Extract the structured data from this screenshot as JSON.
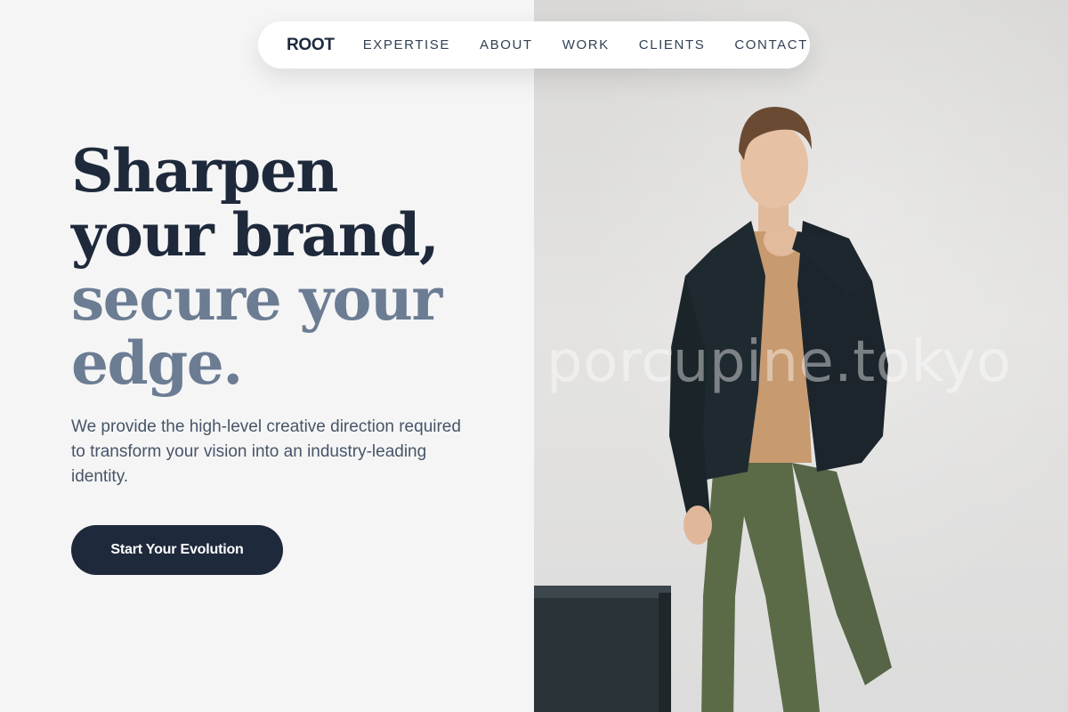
{
  "nav": {
    "brand": "ROOT",
    "links": [
      "EXPERTISE",
      "ABOUT",
      "WORK",
      "CLIENTS",
      "CONTACT"
    ]
  },
  "hero": {
    "headline_lines_dark": [
      "Sharpen",
      "your brand,"
    ],
    "headline_lines_muted": [
      "secure your",
      "edge."
    ],
    "subtext": "We provide the high-level creative direction required to transform your vision into an industry-leading identity.",
    "cta_label": "Start Your Evolution"
  },
  "watermark": "porcupine.tokyo",
  "colors": {
    "primary": "#1e293b",
    "muted_heading": "#6b7c93",
    "body_text": "#475569",
    "background": "#f5f5f5"
  }
}
